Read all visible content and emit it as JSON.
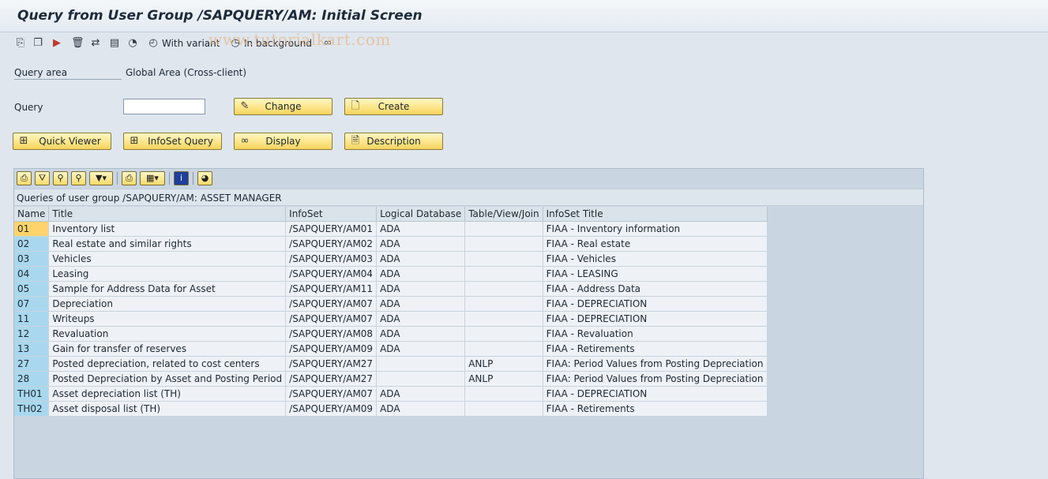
{
  "window": {
    "title": "Query from User Group /SAPQUERY/AM: Initial Screen"
  },
  "toolbar": {
    "icons": [
      "execute-icon",
      "copy-icon",
      "execute-multi-icon",
      "delete-icon",
      "transport-icon",
      "print-icon",
      "variant-icon",
      "clock-icon"
    ],
    "with_variant_label": "With variant",
    "in_background_label": "In background",
    "watermark": "www.tutorialkart.com"
  },
  "form": {
    "query_area_label": "Query area",
    "query_area_value": "Global Area (Cross-client)",
    "query_label": "Query",
    "query_value": "",
    "change_label": "Change",
    "create_label": "Create",
    "quick_viewer_label": "Quick Viewer",
    "infoset_query_label": "InfoSet Query",
    "display_label": "Display",
    "description_label": "Description"
  },
  "alv": {
    "title": "Queries of user group /SAPQUERY/AM: ASSET MANAGER",
    "columns": [
      "Name",
      "Title",
      "InfoSet",
      "Logical Database",
      "Table/View/Join",
      "InfoSet Title"
    ],
    "rows": [
      [
        "01",
        "Inventory list",
        "/SAPQUERY/AM01",
        "ADA",
        "",
        "FIAA - Inventory information"
      ],
      [
        "02",
        "Real estate and similar rights",
        "/SAPQUERY/AM02",
        "ADA",
        "",
        "FIAA - Real estate"
      ],
      [
        "03",
        "Vehicles",
        "/SAPQUERY/AM03",
        "ADA",
        "",
        "FIAA - Vehicles"
      ],
      [
        "04",
        "Leasing",
        "/SAPQUERY/AM04",
        "ADA",
        "",
        "FIAA - LEASING"
      ],
      [
        "05",
        "Sample for Address Data for Asset",
        "/SAPQUERY/AM11",
        "ADA",
        "",
        "FIAA - Address Data"
      ],
      [
        "07",
        "Depreciation",
        "/SAPQUERY/AM07",
        "ADA",
        "",
        "FIAA - DEPRECIATION"
      ],
      [
        "11",
        "Writeups",
        "/SAPQUERY/AM07",
        "ADA",
        "",
        "FIAA - DEPRECIATION"
      ],
      [
        "12",
        "Revaluation",
        "/SAPQUERY/AM08",
        "ADA",
        "",
        "FIAA - Revaluation"
      ],
      [
        "13",
        "Gain for transfer of reserves",
        "/SAPQUERY/AM09",
        "ADA",
        "",
        "FIAA - Retirements"
      ],
      [
        "27",
        "Posted depreciation, related to cost centers",
        "/SAPQUERY/AM27",
        "",
        "ANLP",
        "FIAA: Period Values from Posting Depreciation"
      ],
      [
        "28",
        "Posted Depreciation by Asset and Posting Period",
        "/SAPQUERY/AM27",
        "",
        "ANLP",
        "FIAA: Period Values from Posting Depreciation"
      ],
      [
        "TH01",
        "Asset depreciation list (TH)",
        "/SAPQUERY/AM07",
        "ADA",
        "",
        "FIAA - DEPRECIATION"
      ],
      [
        "TH02",
        "Asset disposal list (TH)",
        "/SAPQUERY/AM09",
        "ADA",
        "",
        "FIAA - Retirements"
      ]
    ]
  },
  "colors": {
    "background": "#dfe6ee",
    "button": "#fce58a",
    "key_cell": "#a9d8ee",
    "selected_key": "#ffd36b"
  }
}
